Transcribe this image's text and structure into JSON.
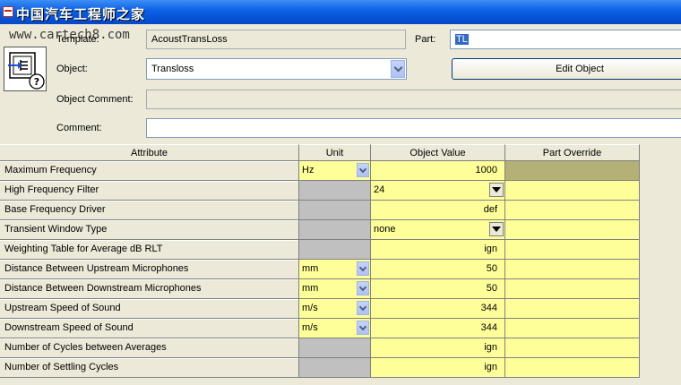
{
  "window": {
    "title": "中国汽车工程师之家"
  },
  "watermark": "www.cartech8.com",
  "form": {
    "template_label": "Template:",
    "template_value": "AcoustTransLoss",
    "part_label": "Part:",
    "part_value": "TL",
    "object_label": "Object:",
    "object_value": "Transloss",
    "edit_object_button": "Edit Object",
    "object_comment_label": "Object Comment:",
    "object_comment_value": "",
    "comment_label": "Comment:",
    "comment_value": ""
  },
  "table": {
    "headers": {
      "attribute": "Attribute",
      "unit": "Unit",
      "object_value": "Object Value",
      "part_override": "Part Override"
    },
    "rows": [
      {
        "attribute": "Maximum Frequency",
        "unit": "Hz",
        "value": "1000"
      },
      {
        "attribute": "High Frequency Filter",
        "unit": "",
        "value": "24"
      },
      {
        "attribute": "Base Frequency Driver",
        "unit": "",
        "value": "def"
      },
      {
        "attribute": "Transient Window Type",
        "unit": "",
        "value": "none"
      },
      {
        "attribute": "Weighting Table for Average dB RLT",
        "unit": "",
        "value": "ign"
      },
      {
        "attribute": "Distance Between Upstream Microphones",
        "unit": "mm",
        "value": "50"
      },
      {
        "attribute": "Distance Between Downstream Microphones",
        "unit": "mm",
        "value": "50"
      },
      {
        "attribute": "Upstream Speed of Sound",
        "unit": "m/s",
        "value": "344"
      },
      {
        "attribute": "Downstream Speed of Sound",
        "unit": "m/s",
        "value": "344"
      },
      {
        "attribute": "Number of Cycles between Averages",
        "unit": "",
        "value": "ign"
      },
      {
        "attribute": "Number of Settling Cycles",
        "unit": "",
        "value": "ign"
      }
    ]
  },
  "colors": {
    "title_bar": "#0a5fe3",
    "editable_cell": "#ffff99",
    "override_active": "#b4b076",
    "disabled_unit": "#c0c0c0"
  },
  "icons": {
    "template": "template-help-icon",
    "window": "window-icon"
  }
}
